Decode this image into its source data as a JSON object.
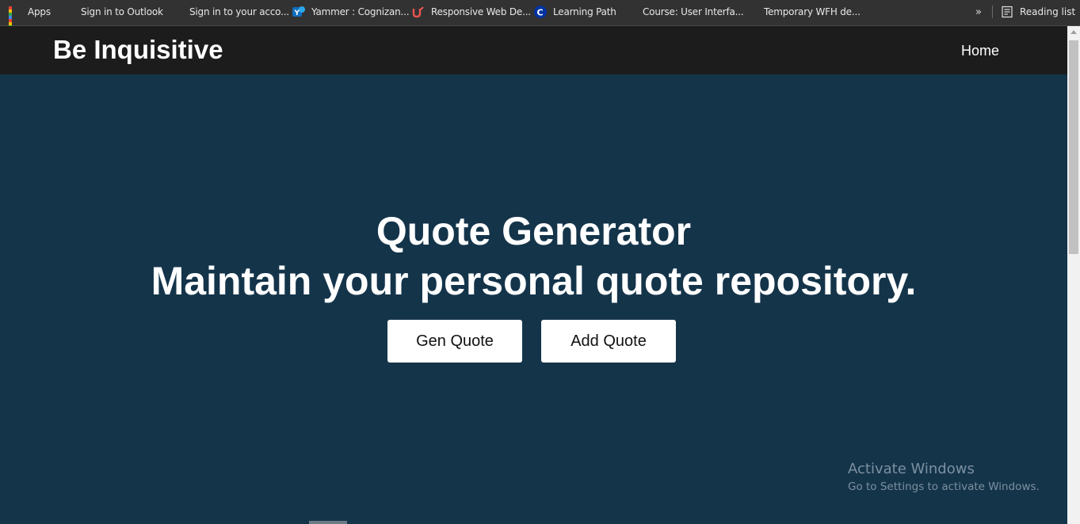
{
  "bookmarks": {
    "apps_label": "Apps",
    "items": [
      {
        "label": "Sign in to Outlook",
        "icon": "microsoft-icon"
      },
      {
        "label": "Sign in to your acco...",
        "icon": "microsoft-icon"
      },
      {
        "label": "Yammer : Cognizan...",
        "icon": "yammer-icon"
      },
      {
        "label": "Responsive Web De...",
        "icon": "udemy-icon"
      },
      {
        "label": "Learning Path",
        "icon": "cognizant-icon"
      },
      {
        "label": "Course: User Interfa...",
        "icon": "microsoft-icon"
      },
      {
        "label": "Temporary WFH de...",
        "icon": "microsoft-icon"
      }
    ],
    "more_label": "»",
    "reading_list_label": "Reading list"
  },
  "navbar": {
    "brand": "Be Inquisitive",
    "home_label": "Home"
  },
  "hero": {
    "title": "Quote Generator",
    "subtitle": "Maintain your personal quote repository.",
    "gen_button": "Gen Quote",
    "add_button": "Add Quote"
  },
  "watermark": {
    "title": "Activate Windows",
    "subtitle": "Go to Settings to activate Windows."
  },
  "colors": {
    "hero_bg": "#14344a",
    "navbar_bg": "#1c1c1c",
    "bookmarks_bg": "#323232"
  }
}
